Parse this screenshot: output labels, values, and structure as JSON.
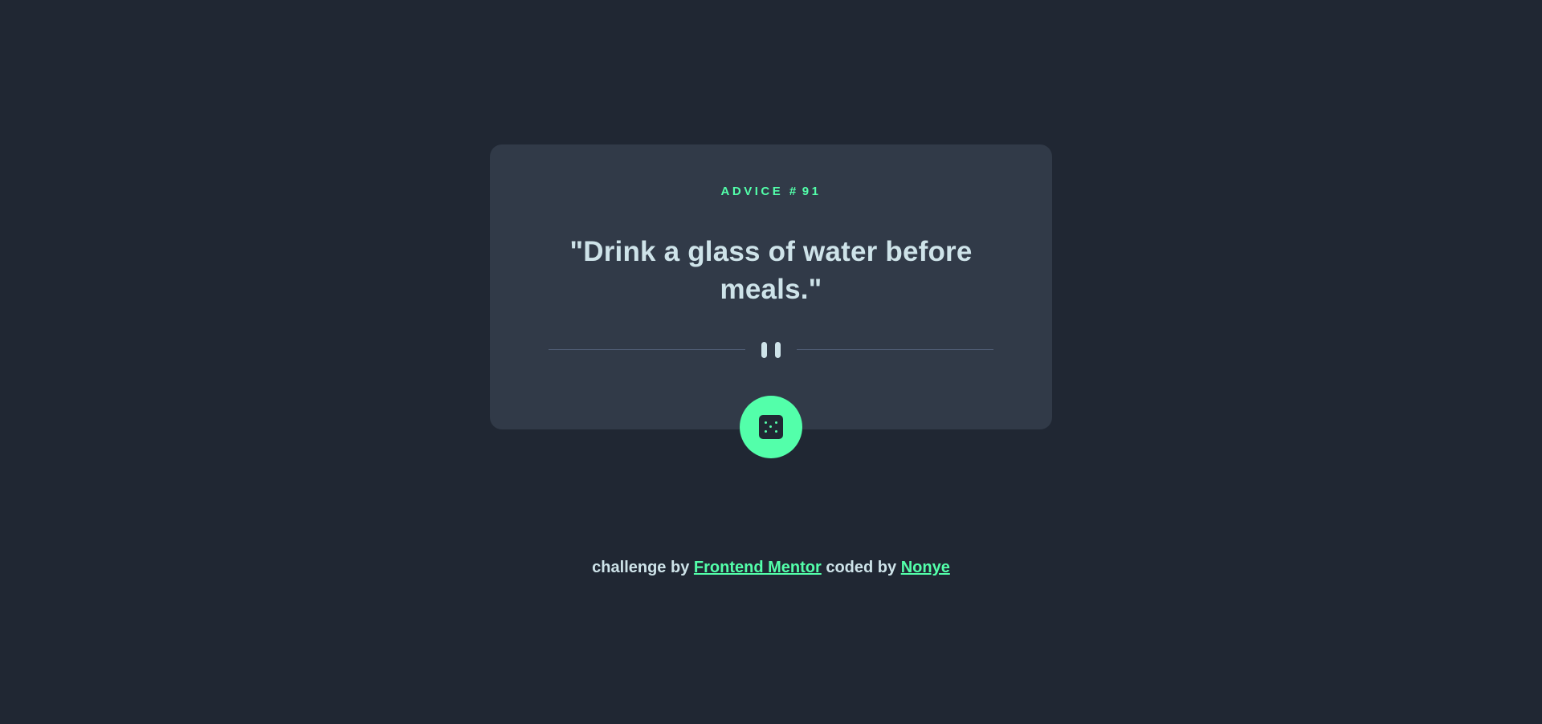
{
  "advice": {
    "label": "ADVICE",
    "hash": "#",
    "id": "91",
    "quote": "\"Drink a glass of water before meals.\""
  },
  "controls": {
    "dice_icon": "dice-icon",
    "divider_icon": "pause-icon"
  },
  "footer": {
    "prefix": "challenge by",
    "link1": "Frontend Mentor",
    "middle": "coded by",
    "link2": "Nonye"
  },
  "colors": {
    "background": "#202733",
    "card": "#313a48",
    "accent": "#53ffaa",
    "text": "#cee3e9",
    "divider": "#4f5d74"
  }
}
